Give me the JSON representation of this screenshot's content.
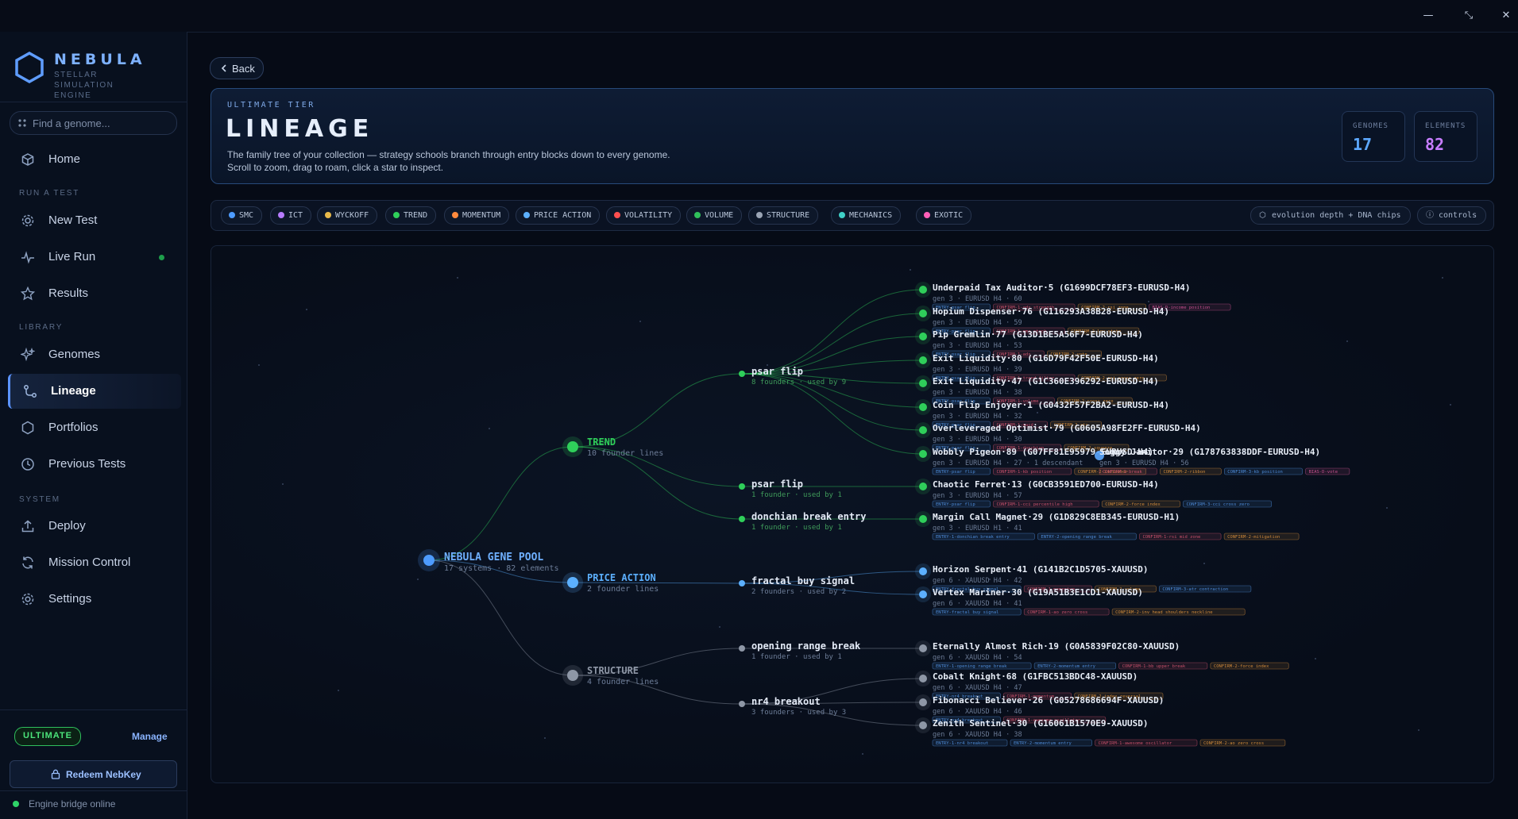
{
  "window": {
    "minimize": "—",
    "restore": "⤡",
    "close": "✕"
  },
  "brand": {
    "name": "NEBULA",
    "subtitle": "STELLAR SIMULATION ENGINE"
  },
  "search": {
    "placeholder": "Find a genome..."
  },
  "sections": {
    "run": "RUN A TEST",
    "library": "LIBRARY",
    "system": "SYSTEM"
  },
  "nav": {
    "home": "Home",
    "new_test": "New Test",
    "live_run": "Live Run",
    "results": "Results",
    "genomes": "Genomes",
    "lineage": "Lineage",
    "portfolios": "Portfolios",
    "previous_tests": "Previous Tests",
    "deploy": "Deploy",
    "mission_control": "Mission Control",
    "settings": "Settings"
  },
  "account": {
    "tier": "ULTIMATE",
    "manage": "Manage",
    "redeem": "Redeem NebKey",
    "engine_status": "Engine bridge online"
  },
  "back_label": "Back",
  "hero": {
    "tier": "ULTIMATE TIER",
    "title": "LINEAGE",
    "description": "The family tree of your collection — strategy schools branch through entry blocks down to every genome. Scroll to zoom, drag to roam, click a star to inspect.",
    "stats": [
      {
        "label": "GENOMES",
        "value": "17",
        "color": "#5da8ff"
      },
      {
        "label": "ELEMENTS",
        "value": "82",
        "color": "#c77dff"
      }
    ]
  },
  "filters": [
    {
      "label": "SMC",
      "color": "#4d9bff"
    },
    {
      "label": "ICT",
      "color": "#b77cff"
    },
    {
      "label": "WYCKOFF",
      "color": "#e8b94a"
    },
    {
      "label": "TREND",
      "color": "#2fcf5a"
    },
    {
      "label": "MOMENTUM",
      "color": "#ff8a3d"
    },
    {
      "label": "PRICE ACTION",
      "color": "#5cb0ff"
    },
    {
      "label": "VOLATILITY",
      "color": "#ff4f4f"
    },
    {
      "label": "VOLUME",
      "color": "#2fbf5a"
    },
    {
      "label": "STRUCTURE",
      "color": "#9aa4b4"
    },
    {
      "label": "MECHANICS",
      "color": "#3fd1c8"
    },
    {
      "label": "EXOTIC",
      "color": "#ff5fb8"
    }
  ],
  "toggles": [
    {
      "label": "evolution depth + DNA chips",
      "glyph": "⬡"
    },
    {
      "label": "controls",
      "glyph": "ⓘ"
    }
  ],
  "tree": {
    "root": {
      "name": "NEBULA GENE POOL",
      "sub": "17 systems · 82 elements",
      "color": "#4d9bff"
    },
    "schools": [
      {
        "name": "TREND",
        "sub": "10 founder lines",
        "color": "#2fcf5a"
      },
      {
        "name": "PRICE ACTION",
        "sub": "2 founder lines",
        "color": "#5cb0ff"
      },
      {
        "name": "STRUCTURE",
        "sub": "4 founder lines",
        "color": "#8e97a6"
      }
    ],
    "entries": [
      {
        "name": "psar flip",
        "sub": "8 founders · used by 9",
        "school": 0
      },
      {
        "name": "psar flip",
        "sub": "1 founder · used by 1",
        "school": 0
      },
      {
        "name": "donchian break entry",
        "sub": "1 founder · used by 1",
        "school": 0
      },
      {
        "name": "fractal buy signal",
        "sub": "2 founders · used by 2",
        "school": 1
      },
      {
        "name": "opening range break",
        "sub": "1 founder · used by 1",
        "school": 2
      },
      {
        "name": "nr4 breakout",
        "sub": "3 founders · used by 3",
        "school": 2
      }
    ],
    "genomes": [
      {
        "name": "Underpaid Tax Auditor·5 (G1699DCF78EF3-EURUSD-H4)",
        "sub": "gen 3 · EURUSD H4 · 60",
        "entry": 0,
        "chips": [
          "ENTRY-psar flip",
          "CONFIRM-1-adx strength",
          "CONFIRM-2-rsi zone",
          "BIAS-D-income position"
        ]
      },
      {
        "name": "Hopium Dispenser·76 (G116293A38B28-EURUSD-H4)",
        "sub": "gen 3 · EURUSD H4 · 59",
        "entry": 0,
        "chips": [
          "ENTRY-psar flip",
          "CONFIRM-1-ema stack",
          "CONFIRM-2-low state"
        ]
      },
      {
        "name": "Pip Gremlin·77 (G13D1BE5A56F7-EURUSD-H4)",
        "sub": "gen 3 · EURUSD H4 · 53",
        "entry": 0,
        "chips": [
          "ENTRY-psar flip",
          "CONFIRM-1-adx",
          "CONFIRM-2-vote"
        ]
      },
      {
        "name": "Exit Liquidity·80 (G16D79F42F50E-EURUSD-H4)",
        "sub": "gen 3 · EURUSD H4 · 39",
        "entry": 0,
        "chips": [
          "ENTRY-psar flip",
          "CONFIRM-1-trend filter",
          "CONFIRM-2-rsi cross zero"
        ]
      },
      {
        "name": "Exit Liquidity·47 (G1C360E396292-EURUSD-H4)",
        "sub": "gen 3 · EURUSD H4 · 38",
        "entry": 0,
        "chips": [
          "ENTRY-psar flip",
          "CONFIRM-1-volume",
          "CONFIRM-2-cross zero"
        ]
      },
      {
        "name": "Coin Flip Enjoyer·1 (G0432F57F2BA2-EURUSD-H4)",
        "sub": "gen 3 · EURUSD H4 · 32",
        "entry": 0,
        "chips": [
          "ENTRY-psar flip",
          "CONFIRM-1-macd",
          "CONFIRM-2-atr"
        ]
      },
      {
        "name": "Overleveraged Optimist·79 (G0605A98FE2FF-EURUSD-H4)",
        "sub": "gen 3 · EURUSD H4 · 30",
        "entry": 0,
        "chips": [
          "ENTRY-psar flip",
          "CONFIRM-1-donchian",
          "CONFIRM-2-squeeze"
        ]
      },
      {
        "name": "Wobbly Pigeon·89 (G07FF81E95979-EURUSD-H4)",
        "sub": "gen 3 · EURUSD H4 · 27 · 1 descendant",
        "entry": 0,
        "chips": [
          "ENTRY-psar flip",
          "CONFIRM-1-kb position",
          "CONFIRM-2-indicator"
        ]
      },
      {
        "name": "Soggy Janitor·29 (G178763838DDF-EURUSD-H4)",
        "sub": "gen 3 · EURUSD H4 · 56",
        "entry": 0,
        "child": true,
        "chips": [
          "CONFIRM-1-break",
          "CONFIRM-2-ribbon",
          "CONFIRM-3-kb position",
          "BIAS-D-vote"
        ]
      },
      {
        "name": "Chaotic Ferret·13 (G0CB3591ED700-EURUSD-H4)",
        "sub": "gen 3 · EURUSD H4 · 57",
        "entry": 1,
        "chips": [
          "ENTRY-psar flip",
          "CONFIRM-1-cci percentile high",
          "CONFIRM-2-force index",
          "CONFIRM-3-cci cross zero"
        ]
      },
      {
        "name": "Margin Call Magnet·29 (G1D829C8EB345-EURUSD-H1)",
        "sub": "gen 3 · EURUSD H1 · 41",
        "entry": 2,
        "chips": [
          "ENTRY-1-donchian break entry",
          "ENTRY-2-opening range break",
          "CONFIRM-1-rsi mid zone",
          "CONFIRM-2-mitigation"
        ]
      },
      {
        "name": "Horizon Serpent·41 (G141B2C1D5705-XAUUSD)",
        "sub": "gen 6 · XAUUSD H4 · 42",
        "entry": 3,
        "chips": [
          "ENTRY-fractal buy signal",
          "CONFIRM-1-momentum",
          "CONFIRM-2-volume",
          "CONFIRM-3-atr contraction"
        ]
      },
      {
        "name": "Vertex Mariner·30 (G19A51B3E1CD1-XAUUSD)",
        "sub": "gen 6 · XAUUSD H4 · 41",
        "entry": 3,
        "chips": [
          "ENTRY-fractal buy signal",
          "CONFIRM-1-ao zero cross",
          "CONFIRM-2-inv head shoulders neckline"
        ]
      },
      {
        "name": "Eternally Almost Rich·19 (G0A5839F02C80-XAUUSD)",
        "sub": "gen 6 · XAUUSD H4 · 54",
        "entry": 4,
        "chips": [
          "ENTRY-1-opening range break",
          "ENTRY-2-momentum entry",
          "CONFIRM-1-bb upper break",
          "CONFIRM-2-force index"
        ]
      },
      {
        "name": "Cobalt Knight·68 (G1FBC513BDC48-XAUUSD)",
        "sub": "gen 6 · XAUUSD H4 · 47",
        "entry": 5,
        "chips": [
          "ENTRY-nr4 breakout",
          "CONFIRM-1-momentum",
          "CONFIRM-2-index reversal"
        ]
      },
      {
        "name": "Fibonacci Believer·26 (G05278686694F-XAUUSD)",
        "sub": "gen 6 · XAUUSD H4 · 46",
        "entry": 5,
        "chips": [
          "ENTRY-nr4 breakout",
          "CONFIRM-1-awesome oscillator"
        ]
      },
      {
        "name": "Zenith Sentinel·30 (G16061B1570E9-XAUUSD)",
        "sub": "gen 6 · XAUUSD H4 · 38",
        "entry": 5,
        "chips": [
          "ENTRY-1-nr4 breakout",
          "ENTRY-2-momentum entry",
          "CONFIRM-1-awesome oscillator",
          "CONFIRM-2-ao zero cross"
        ]
      }
    ]
  }
}
